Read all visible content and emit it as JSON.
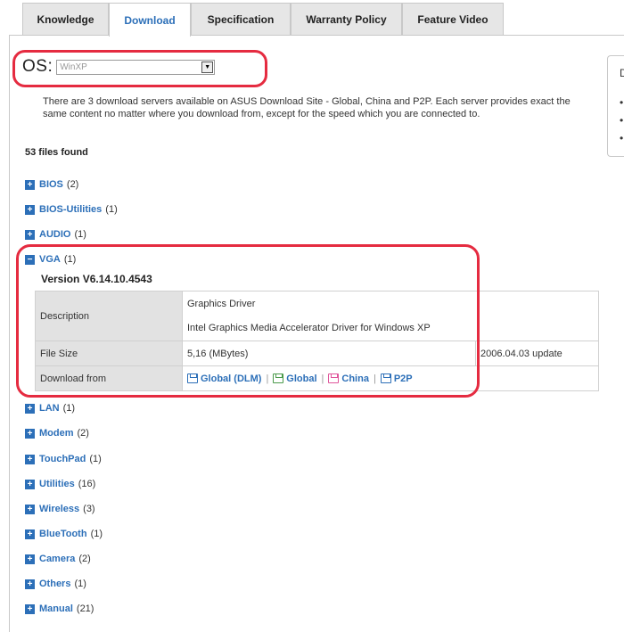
{
  "tabs": [
    "Knowledge",
    "Download",
    "Specification",
    "Warranty Policy",
    "Feature Video"
  ],
  "active_tab": "Download",
  "os": {
    "label": "OS:",
    "selected": "WinXP"
  },
  "info_text": "There are 3 download servers available on ASUS Download Site - Global, China and P2P. Each server provides exact the same content no matter where you download from, except for the speed which you are connected to.",
  "side_box": {
    "title": "D",
    "bullets": [
      "•",
      "•",
      "•"
    ]
  },
  "files_found": "53 files found",
  "categories_before": [
    {
      "name": "BIOS",
      "count": "(2)"
    },
    {
      "name": "BIOS-Utilities",
      "count": "(1)"
    },
    {
      "name": "AUDIO",
      "count": "(1)"
    }
  ],
  "expanded": {
    "name": "VGA",
    "count": "(1)",
    "version": "Version  V6.14.10.4543",
    "description_label": "Description",
    "description_lines": [
      "Graphics Driver",
      "Intel Graphics Media Accelerator Driver for Windows XP"
    ],
    "file_size_label": "File Size",
    "file_size": "5,16 (MBytes)",
    "date": "2006.04.03  update",
    "download_label": "Download from",
    "links": [
      "Global (DLM)",
      "Global",
      "China",
      "P2P"
    ],
    "link_separator": "|"
  },
  "categories_after": [
    {
      "name": "LAN",
      "count": "(1)"
    },
    {
      "name": "Modem",
      "count": "(2)"
    },
    {
      "name": "TouchPad",
      "count": "(1)"
    },
    {
      "name": "Utilities",
      "count": "(16)"
    },
    {
      "name": "Wireless",
      "count": "(3)"
    },
    {
      "name": "BlueTooth",
      "count": "(1)"
    },
    {
      "name": "Camera",
      "count": "(2)"
    },
    {
      "name": "Others",
      "count": "(1)"
    },
    {
      "name": "Manual",
      "count": "(21)"
    }
  ],
  "icons": {
    "expand": "plus-box-icon",
    "collapse": "minus-box-icon",
    "download": "floppy-disk-icon",
    "dropdown": "chevron-down-icon"
  },
  "colors": {
    "link": "#2c6fb8",
    "highlight": "#e52b40",
    "label_bg": "#e2e2e2"
  }
}
